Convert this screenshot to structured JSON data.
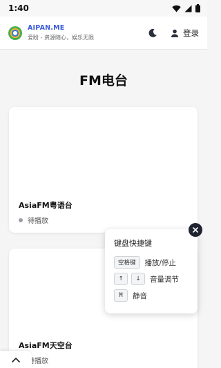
{
  "status_bar": {
    "time": "1:40"
  },
  "header": {
    "brand_name": "AIPAN.ME",
    "slogan": "爱盼 - 资源随心，娱乐无限",
    "login_label": "登录"
  },
  "page": {
    "title": "FM电台"
  },
  "stations": [
    {
      "name": "AsiaFM粤语台",
      "status": "待播放"
    },
    {
      "name": "AsiaFM天空台",
      "status": "待播放"
    }
  ],
  "shortcuts": {
    "title": "键盘快捷键",
    "items": [
      {
        "keys": [
          "空格键"
        ],
        "action": "播放/停止"
      },
      {
        "keys": [
          "↑",
          "↓"
        ],
        "action": "音量调节"
      },
      {
        "keys": [
          "M"
        ],
        "action": "静音"
      }
    ]
  },
  "icons": {
    "moon": "moon-icon",
    "user": "user-icon",
    "close": "close-icon",
    "scroll_up": "chevron-up-icon"
  },
  "colors": {
    "brand": "#3b5bdb",
    "close_button": "#1f2430",
    "status_dot": "#9aa0a6"
  }
}
